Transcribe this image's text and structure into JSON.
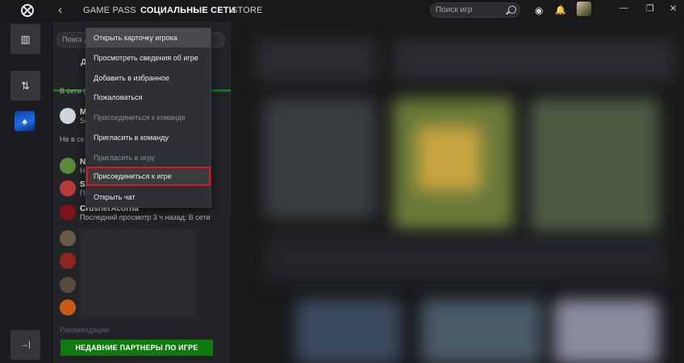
{
  "topbar": {
    "tabs": [
      "GAME PASS",
      "СОЦИАЛЬНЫЕ СЕТИ",
      "STORE"
    ],
    "active_tab": "СОЦИАЛЬНЫЕ СЕТИ",
    "search_placeholder": "Поиск игр",
    "icons": [
      "xbox-logo-icon",
      "back-arrow-icon",
      "search-icon",
      "achievements-icon",
      "notifications-icon",
      "avatar",
      "minimize-icon",
      "restore-icon",
      "close-icon"
    ],
    "glyphs": {
      "back": "‹",
      "achievements": "◉",
      "bell": "🔔",
      "min": "—",
      "restore": "❐",
      "close": "✕"
    }
  },
  "rail": {
    "glyphs": {
      "library": "▥",
      "filter": "⇅",
      "game": "♠",
      "collapse": "→|"
    }
  },
  "social": {
    "search_placeholder": "Поиск д",
    "tab_friends_letter": "Д",
    "online_label": "В сети (",
    "offline_label": "Не в се",
    "friends": [
      {
        "name": "M",
        "status": "Se",
        "color": "#cfd6d6"
      },
      {
        "name": "N",
        "status": "H",
        "color": "#5a8a3a"
      },
      {
        "name": "S",
        "status": "П",
        "color": "#b93a3a"
      },
      {
        "name": "CrusherAcorna",
        "status": "Последний просмотр 3 ч назад: В сети",
        "color": "#7a1416"
      },
      {
        "name": "",
        "status": "",
        "color": "#6b5a4a"
      },
      {
        "name": "",
        "status": "",
        "color": "#8f2420"
      },
      {
        "name": "",
        "status": "",
        "color": "#5a4a40"
      },
      {
        "name": "",
        "status": "",
        "color": "#c85a18"
      }
    ],
    "recent_label": "Рекомендации",
    "recent_button": "НЕДАВНИЕ ПАРТНЕРЫ ПО ИГРЕ"
  },
  "context_menu": {
    "items": [
      {
        "label": "Открыть карточку игрока",
        "enabled": true
      },
      {
        "label": "Просмотреть сведения об игре",
        "enabled": true
      },
      {
        "label": "Добавить в избранное",
        "enabled": true
      },
      {
        "label": "Пожаловаться",
        "enabled": true
      },
      {
        "label": "Присоединиться к команде",
        "enabled": false
      },
      {
        "label": "Пригласить в команду",
        "enabled": true
      },
      {
        "label": "Пригласить в игру",
        "enabled": false
      },
      {
        "label": "Присоединиться к игре",
        "enabled": true,
        "highlighted": true
      },
      {
        "label": "Открыть чат",
        "enabled": true
      }
    ]
  },
  "colors": {
    "accent_green": "#107c10",
    "highlight_red": "#e1161c"
  }
}
